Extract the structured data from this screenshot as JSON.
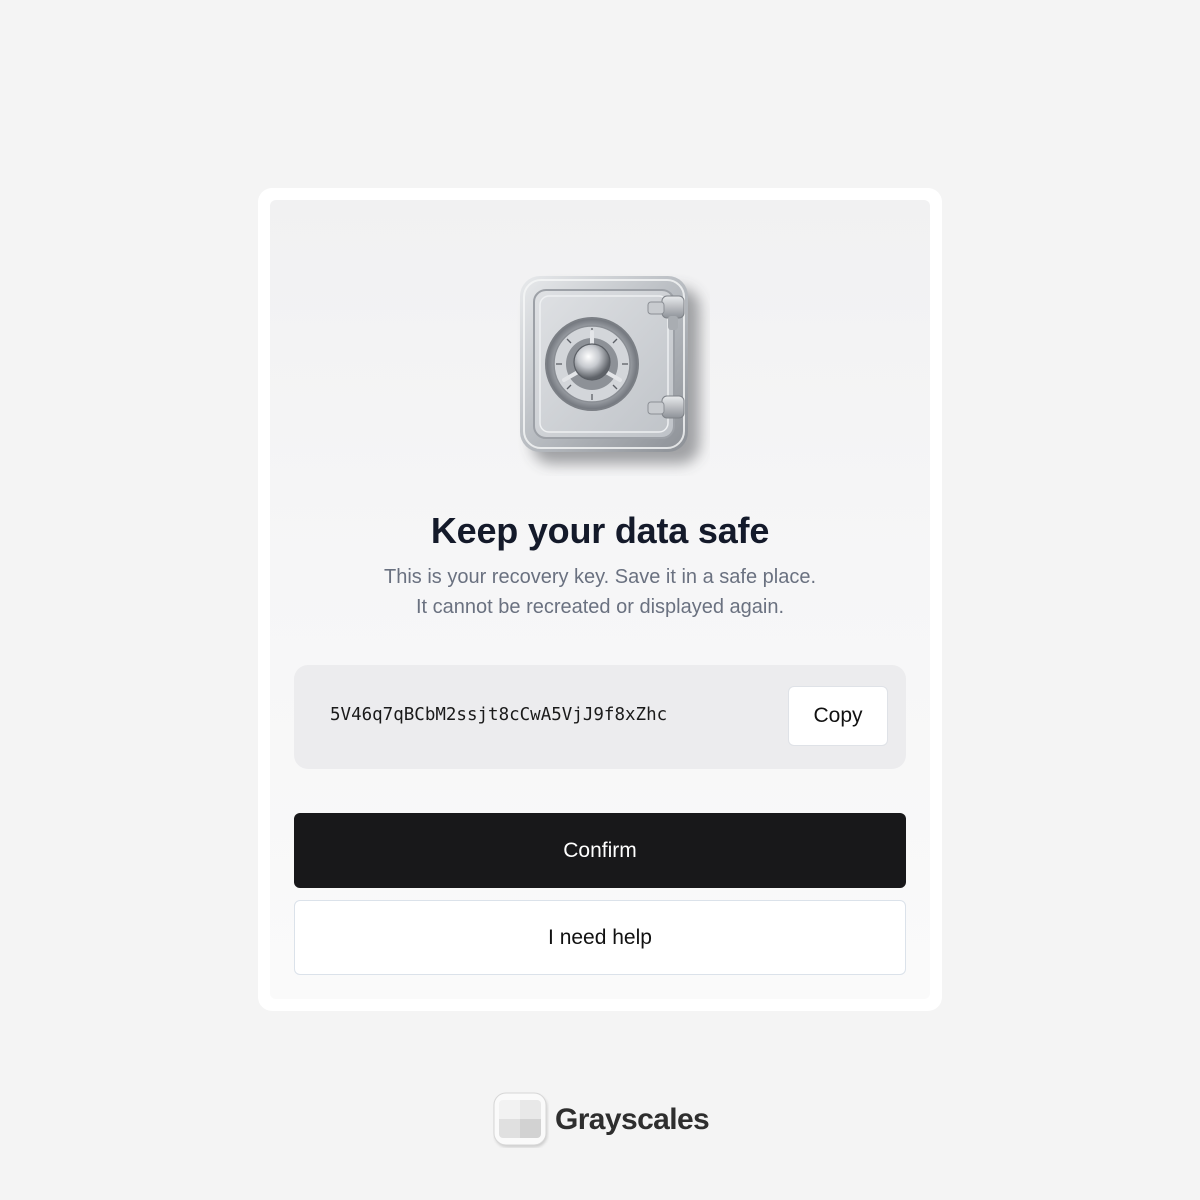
{
  "dialog": {
    "title": "Keep your data safe",
    "subtitle_line1": "This is your recovery key. Save it in a safe place.",
    "subtitle_line2": "It cannot be recreated or displayed again."
  },
  "recovery_key": {
    "value": "5V46q7qBCbM2ssjt8cCwA5VjJ9f8xZhc",
    "copy_label": "Copy"
  },
  "actions": {
    "confirm_label": "Confirm",
    "help_label": "I need help"
  },
  "brand": {
    "name": "Grayscales"
  },
  "icons": {
    "illustration": "safe-icon",
    "brand_logo": "grayscales-logo-icon"
  },
  "colors": {
    "page_bg": "#f4f4f4",
    "primary_button": "#18181a",
    "title": "#141a2a",
    "subtitle": "#6a7180",
    "key_box": "#ececee"
  }
}
